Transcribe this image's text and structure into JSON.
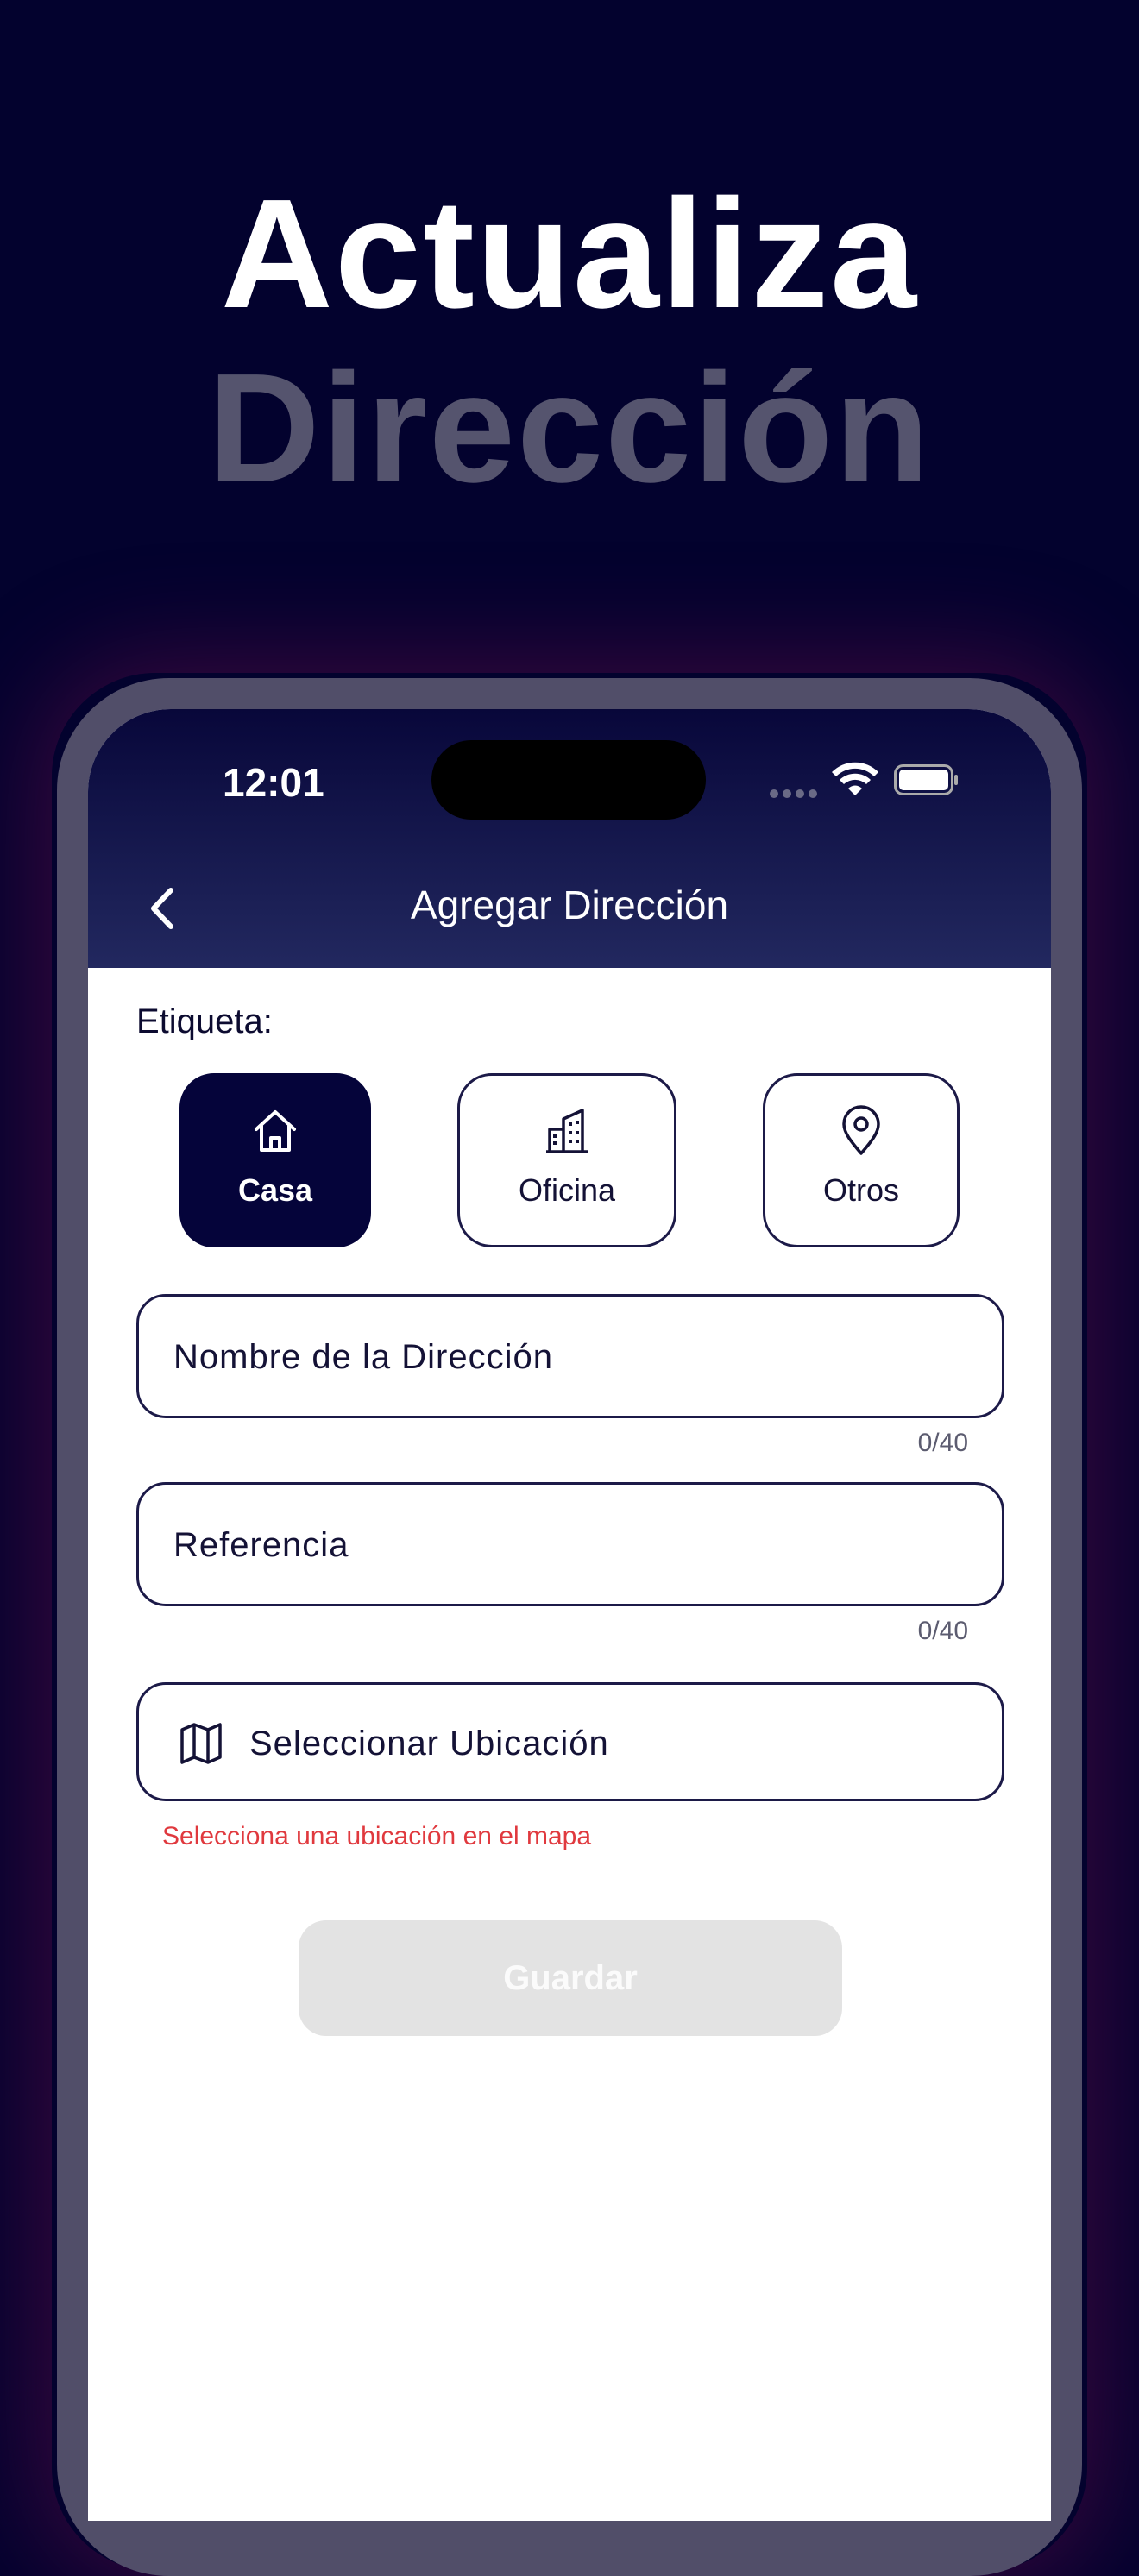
{
  "promo": {
    "line1": "Actualiza",
    "line2": "Dirección"
  },
  "status_bar": {
    "time": "12:01"
  },
  "header": {
    "title": "Agregar Dirección",
    "back_icon": "chevron-left-icon"
  },
  "form": {
    "label": "Etiqueta:",
    "tags": [
      {
        "label": "Casa",
        "icon": "home-icon",
        "selected": true
      },
      {
        "label": "Oficina",
        "icon": "building-icon",
        "selected": false
      },
      {
        "label": "Otros",
        "icon": "location-pin-icon",
        "selected": false
      }
    ],
    "name_field": {
      "placeholder": "Nombre de la Dirección",
      "counter": "0/40"
    },
    "reference_field": {
      "placeholder": "Referencia",
      "counter": "0/40"
    },
    "location_button": {
      "label": "Seleccionar Ubicación",
      "icon": "map-icon"
    },
    "error": "Selecciona una ubicación en el mapa",
    "save_label": "Guardar"
  },
  "colors": {
    "background": "#03022e",
    "accent": "#05043a",
    "error": "#e0393e",
    "disabled": "#e3e3e3"
  }
}
